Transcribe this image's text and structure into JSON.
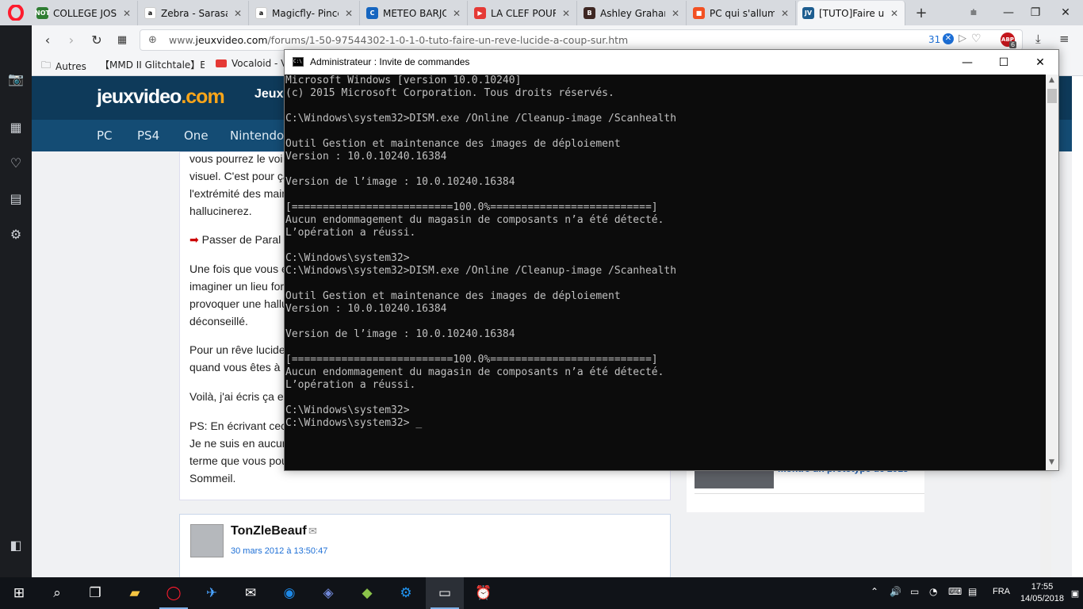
{
  "browser": {
    "tabs": [
      {
        "title": "COLLEGE JOSEP",
        "favicon_color": "#2e7d32",
        "favicon_text": "NOT"
      },
      {
        "title": "Zebra - Sarasa S",
        "favicon_color": "#ffffff",
        "favicon_text": "a"
      },
      {
        "title": "Magicfly- Pince",
        "favicon_color": "#ffffff",
        "favicon_text": "a"
      },
      {
        "title": "METEO BARJOL",
        "favicon_color": "#1565c0",
        "favicon_text": "C"
      },
      {
        "title": "LA CLEF POUR L",
        "favicon_color": "#e53935",
        "favicon_text": "▶"
      },
      {
        "title": "Ashley Graham",
        "favicon_color": "#3e2723",
        "favicon_text": "B"
      },
      {
        "title": "PC qui s'allume",
        "favicon_color": "#f25022",
        "favicon_text": "■"
      },
      {
        "title": "[TUTO]Faire un",
        "favicon_color": "#1d5d8f",
        "favicon_text": "JV"
      }
    ],
    "url_prefix": "www.",
    "url_domain": "jeuxvideo.com",
    "url_path": "/forums/1-50-97544302-1-0-1-0-tuto-faire-un-reve-lucide-a-coup-sur.htm",
    "badge_count": "31",
    "abp_count": "6",
    "bookmarks": [
      {
        "label": "Autres",
        "icon": "folder-icon"
      },
      {
        "label": "【MMD II Glitchtale】E",
        "icon": "youtube-icon"
      },
      {
        "label": "Vocaloid - V",
        "icon": "youtube-icon"
      }
    ]
  },
  "jv": {
    "logo_main": "jeuxvideo",
    "logo_tld": ".com",
    "top_menu": "Jeux",
    "nav": [
      "PC",
      "PS4",
      "One",
      "Nintendo S"
    ],
    "article_lines": [
      "vous pourrez le voi",
      "visuel. C'est pour ça",
      "l'extrémité des main",
      "hallucinerez.",
      "Passer de Paral",
      "Une fois que vous é",
      "imaginer un lieu for",
      "provoquer une hallu",
      "déconseillé.",
      "Pour un rêve lucide",
      "quand vous êtes à",
      "Voilà, j'ai écris ça e",
      "PS: En écrivant cec",
      "Je ne suis en aucun",
      "terme que vous pou",
      "Sommeil."
    ],
    "post_author": "TonZleBeauf",
    "post_date": "30 mars 2012 à 13:50:47",
    "side_news": "montre un prototype de 2015"
  },
  "cmd": {
    "title": "Administrateur : Invite de commandes",
    "lines": [
      "Microsoft Windows [version 10.0.10240]",
      "(c) 2015 Microsoft Corporation. Tous droits réservés.",
      "",
      "C:\\Windows\\system32>DISM.exe /Online /Cleanup-image /Scanhealth",
      "",
      "Outil Gestion et maintenance des images de déploiement",
      "Version : 10.0.10240.16384",
      "",
      "Version de l’image : 10.0.10240.16384",
      "",
      "[==========================100.0%==========================]",
      "Aucun endommagement du magasin de composants n’a été détecté.",
      "L’opération a réussi.",
      "",
      "C:\\Windows\\system32>",
      "C:\\Windows\\system32>DISM.exe /Online /Cleanup-image /Scanhealth",
      "",
      "Outil Gestion et maintenance des images de déploiement",
      "Version : 10.0.10240.16384",
      "",
      "Version de l’image : 10.0.10240.16384",
      "",
      "[==========================100.0%==========================]",
      "Aucun endommagement du magasin de composants n’a été détecté.",
      "L’opération a réussi.",
      "",
      "C:\\Windows\\system32>",
      "C:\\Windows\\system32> _"
    ]
  },
  "taskbar": {
    "lang": "FRA",
    "time": "17:55",
    "date": "14/05/2018"
  },
  "colors": {
    "jv_blue": "#0e3a5a",
    "jv_orange": "#f9a51a",
    "accent": "#4a90d9"
  }
}
